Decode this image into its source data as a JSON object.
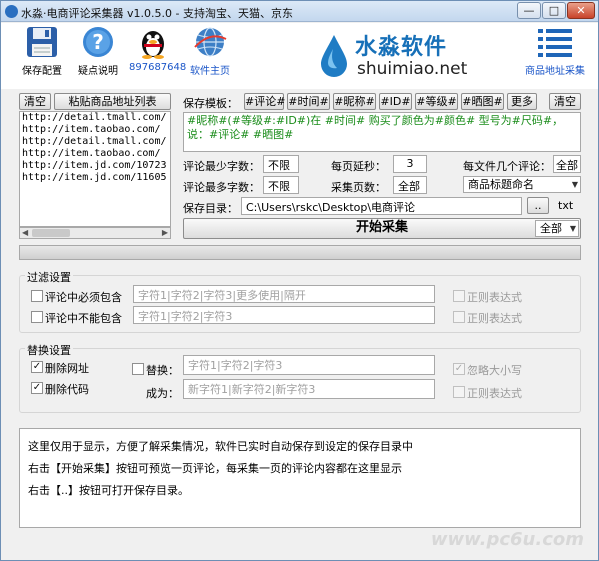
{
  "window": {
    "title": "水淼·电商评论采集器 v1.0.5.0 - 支持淘宝、天猫、京东",
    "min": "—",
    "max": "□",
    "close": "✕"
  },
  "toolbar": {
    "save_config": "保存配置",
    "help": "疑点说明",
    "qq": "897687648",
    "homepage": "软件主页",
    "url_collect": "商品地址采集"
  },
  "brand": {
    "cn": "水淼软件",
    "en": "shuimiao.net"
  },
  "left": {
    "clear_btn": "清空",
    "paste_btn": "粘贴商品地址列表",
    "urls": [
      "http://detail.tmall.com/",
      "http://item.taobao.com/",
      "http://detail.tmall.com/",
      "http://item.taobao.com/",
      "http://item.jd.com/10723",
      "http://item.jd.com/11605"
    ]
  },
  "template": {
    "label": "保存模板：",
    "tags": [
      "#评论#",
      "#时间#",
      "#昵称#",
      "#ID#",
      "#等级#",
      "#晒图#"
    ],
    "more": "更多",
    "clear": "清空",
    "value": "#昵称#(#等级#:#ID#)在 #时间# 购买了颜色为#颜色# 型号为#尺码#，说：#评论# #晒图#"
  },
  "settings": {
    "min_chars_label": "评论最少字数：",
    "min_chars": "不限",
    "max_chars_label": "评论最多字数：",
    "max_chars": "不限",
    "delay_label": "每页延秒：",
    "delay": "3",
    "pages_label": "采集页数：",
    "pages": "全部",
    "per_file_label": "每文件几个评论：",
    "per_file": "全部",
    "naming": "商品标题命名",
    "save_dir_label": "保存目录：",
    "save_dir": "C:\\Users\\rskc\\Desktop\\电商评论",
    "browse": "..",
    "ext": "txt"
  },
  "start": {
    "label": "开始采集",
    "scope": "全部"
  },
  "filter": {
    "title": "过滤设置",
    "must_include_label": "评论中必须包含",
    "must_include_ph": "字符1|字符2|字符3|更多使用|隔开",
    "must_not_label": "评论中不能包含",
    "must_not_ph": "字符1|字符2|字符3",
    "regex1": "正则表达式",
    "regex2": "正则表达式"
  },
  "replace": {
    "title": "替换设置",
    "del_url": "删除网址",
    "del_code": "删除代码",
    "replace_label": "替换：",
    "replace_ph": "字符1|字符2|字符3",
    "to_label": "成为：",
    "to_ph": "新字符1|新字符2|新字符3",
    "ignore_case": "忽略大小写",
    "regex": "正则表达式"
  },
  "log": {
    "line1": "这里仅用于显示，方便了解采集情况，软件已实时自动保存到设定的保存目录中",
    "line2": "右击【开始采集】按钮可预览一页评论，每采集一页的评论内容都在这里显示",
    "line3": "右击【..】按钮可打开保存目录。"
  },
  "watermark": "www.pc6u.com",
  "colors": {
    "brand_blue": "#1770b8",
    "template_green": "#1a8c1a",
    "link_blue": "#1a55c8"
  }
}
